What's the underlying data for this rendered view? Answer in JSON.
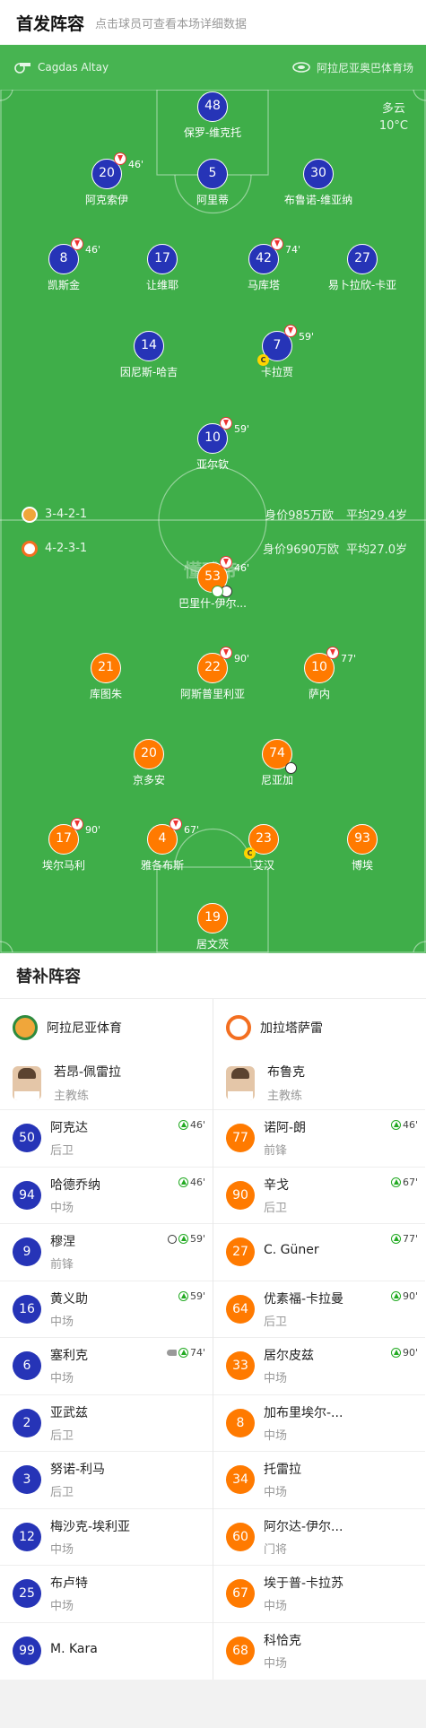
{
  "header": {
    "title": "首发阵容",
    "subtitle": "点击球员可查看本场详细数据"
  },
  "pitch": {
    "referee": "Cagdas Altay",
    "stadium": "阿拉尼亚奥巴体育场",
    "weather": "多云",
    "temperature": "10°C",
    "watermark": "懂球帝",
    "home_formation": "3-4-2-1",
    "home_value": "身价985万欧",
    "home_age": "平均29.4岁",
    "away_formation": "4-2-3-1",
    "away_value": "身价9690万欧",
    "away_age": "平均27.0岁",
    "colors": {
      "home": "#2634b7",
      "away": "#ff7a00",
      "pitch": "#3fae49"
    },
    "home_players": [
      {
        "num": "48",
        "name": "保罗-维克托",
        "sub": ""
      },
      {
        "num": "20",
        "name": "阿克索伊",
        "sub": "46'"
      },
      {
        "num": "5",
        "name": "阿里蒂",
        "sub": ""
      },
      {
        "num": "30",
        "name": "布鲁诺-维亚纳",
        "sub": ""
      },
      {
        "num": "8",
        "name": "凯斯金",
        "sub": "46'"
      },
      {
        "num": "17",
        "name": "让维耶",
        "sub": ""
      },
      {
        "num": "42",
        "name": "马库塔",
        "sub": "74'"
      },
      {
        "num": "27",
        "name": "易卜拉欣-卡亚",
        "sub": ""
      },
      {
        "num": "14",
        "name": "因尼斯-哈吉",
        "sub": ""
      },
      {
        "num": "7",
        "name": "卡拉贾",
        "sub": "59'"
      },
      {
        "num": "10",
        "name": "亚尔钦",
        "sub": "59'"
      }
    ],
    "away_players": [
      {
        "num": "53",
        "name": "巴里什-伊尔...",
        "sub": "46'"
      },
      {
        "num": "21",
        "name": "库图朱",
        "sub": ""
      },
      {
        "num": "22",
        "name": "阿斯普里利亚",
        "sub": "90'"
      },
      {
        "num": "10",
        "name": "萨内",
        "sub": "77'"
      },
      {
        "num": "20",
        "name": "京多安",
        "sub": ""
      },
      {
        "num": "74",
        "name": "尼亚加",
        "sub": ""
      },
      {
        "num": "17",
        "name": "埃尔马利",
        "sub": "90'"
      },
      {
        "num": "4",
        "name": "雅各布斯",
        "sub": "67'"
      },
      {
        "num": "23",
        "name": "艾汉",
        "sub": ""
      },
      {
        "num": "93",
        "name": "博埃",
        "sub": ""
      },
      {
        "num": "19",
        "name": "居文茨",
        "sub": ""
      }
    ]
  },
  "subs": {
    "title": "替补阵容",
    "home": {
      "team": "阿拉尼亚体育",
      "coach": "若昂-佩雷拉",
      "coach_role": "主教练",
      "players": [
        {
          "num": "50",
          "name": "阿克达",
          "pos": "后卫",
          "in": "46'"
        },
        {
          "num": "94",
          "name": "哈德乔纳",
          "pos": "中场",
          "in": "46'"
        },
        {
          "num": "9",
          "name": "穆涅",
          "pos": "前锋",
          "in": "59'"
        },
        {
          "num": "16",
          "name": "黄义助",
          "pos": "中场",
          "in": "59'"
        },
        {
          "num": "6",
          "name": "塞利克",
          "pos": "中场",
          "in": "74'"
        },
        {
          "num": "2",
          "name": "亚武兹",
          "pos": "后卫",
          "in": ""
        },
        {
          "num": "3",
          "name": "努诺-利马",
          "pos": "后卫",
          "in": ""
        },
        {
          "num": "12",
          "name": "梅沙克-埃利亚",
          "pos": "中场",
          "in": ""
        },
        {
          "num": "25",
          "name": "布卢特",
          "pos": "中场",
          "in": ""
        },
        {
          "num": "99",
          "name": "M. Kara",
          "pos": "",
          "in": ""
        }
      ]
    },
    "away": {
      "team": "加拉塔萨雷",
      "coach": "布鲁克",
      "coach_role": "主教练",
      "players": [
        {
          "num": "77",
          "name": "诺阿-朗",
          "pos": "前锋",
          "in": "46'"
        },
        {
          "num": "90",
          "name": "辛戈",
          "pos": "后卫",
          "in": "67'"
        },
        {
          "num": "27",
          "name": "C. Güner",
          "pos": "",
          "in": "77'"
        },
        {
          "num": "64",
          "name": "优素福-卡拉曼",
          "pos": "后卫",
          "in": "90'"
        },
        {
          "num": "33",
          "name": "居尔皮兹",
          "pos": "中场",
          "in": "90'"
        },
        {
          "num": "8",
          "name": "加布里埃尔-...",
          "pos": "中场",
          "in": ""
        },
        {
          "num": "34",
          "name": "托雷拉",
          "pos": "中场",
          "in": ""
        },
        {
          "num": "60",
          "name": "阿尔达-伊尔...",
          "pos": "门将",
          "in": ""
        },
        {
          "num": "67",
          "name": "埃于普-卡拉苏",
          "pos": "中场",
          "in": ""
        },
        {
          "num": "68",
          "name": "科恰克",
          "pos": "中场",
          "in": ""
        }
      ]
    }
  }
}
